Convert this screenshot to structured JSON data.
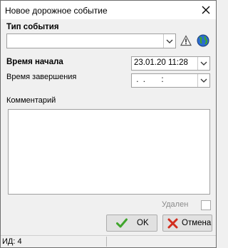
{
  "window": {
    "title": "Новое дорожное событие",
    "close_icon": "close-icon"
  },
  "event_type": {
    "label": "Тип события",
    "value": "",
    "icons": [
      "warning-icon",
      "globe-icon"
    ]
  },
  "start_time": {
    "label": "Время начала",
    "value": "23.01.20 11:28"
  },
  "end_time": {
    "label": "Время завершения",
    "value": " .  .       :"
  },
  "comment": {
    "label": "Комментарий",
    "value": ""
  },
  "deleted": {
    "label": "Удален",
    "checked": false
  },
  "buttons": {
    "ok": "OK",
    "cancel": "Отмена"
  },
  "status": {
    "id_text": "ИД: 4"
  },
  "colors": {
    "ok_check": "#3fa52b",
    "cancel_x": "#d22e1f",
    "globe": "#2b6bd1"
  }
}
